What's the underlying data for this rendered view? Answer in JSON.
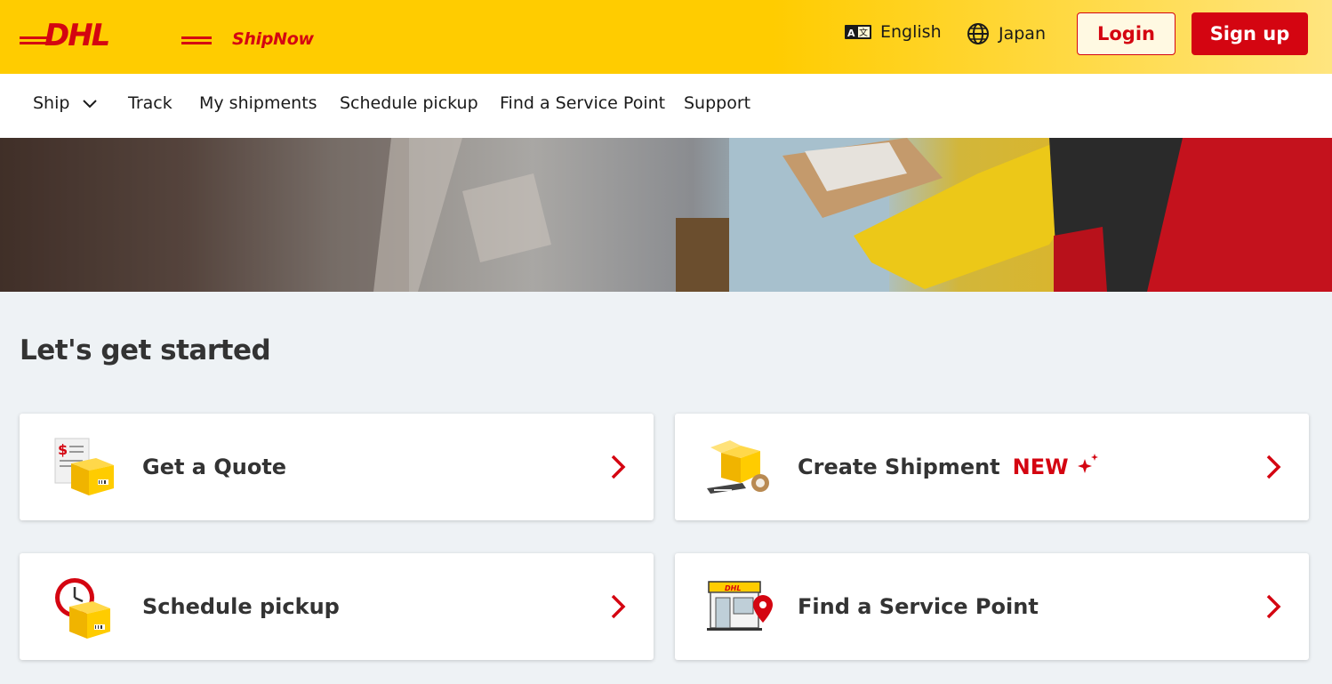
{
  "header": {
    "brand": "DHL",
    "app_name": "ShipNow",
    "language": "English",
    "country": "Japan",
    "login_label": "Login",
    "signup_label": "Sign up"
  },
  "nav": {
    "items": [
      {
        "label": "Ship"
      },
      {
        "label": "Track"
      },
      {
        "label": "My shipments"
      },
      {
        "label": "Schedule pickup"
      },
      {
        "label": "Find a Service Point"
      },
      {
        "label": "Support"
      }
    ]
  },
  "main": {
    "heading": "Let's get started",
    "cards": [
      {
        "label": "Get a Quote",
        "icon": "quote-box-icon"
      },
      {
        "label": "Create Shipment",
        "badge": "NEW",
        "icon": "shipment-box-icon"
      },
      {
        "label": "Schedule pickup",
        "icon": "clock-box-icon"
      },
      {
        "label": "Find a Service Point",
        "icon": "service-point-store-icon"
      }
    ]
  },
  "colors": {
    "brand_yellow": "#ffcc00",
    "brand_red": "#d40511",
    "page_bg": "#eef2f5"
  }
}
